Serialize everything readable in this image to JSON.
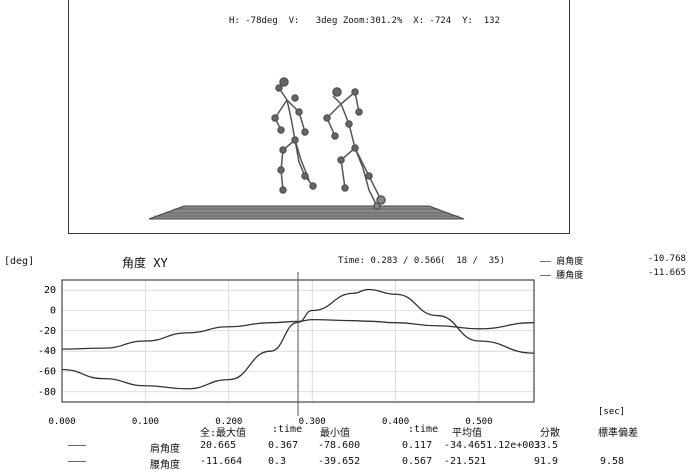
{
  "viewport": {
    "hud": {
      "h": "H: -78deg",
      "v": "V:   3deg",
      "zoom": "Zoom:301.2%",
      "x": "X: -724",
      "y": "Y:  132"
    }
  },
  "graph": {
    "unit": "[deg]",
    "title": "角度 XY",
    "time_readout": "Time: 0.283 / 0.566",
    "frame_readout": "(  18 /  35)",
    "legend": [
      {
        "label": "肩角度",
        "value": "-10.768"
      },
      {
        "label": "腰角度",
        "value": "-11.665"
      }
    ]
  },
  "chart_data": {
    "type": "line",
    "xlabel": "[sec]",
    "ylabel": "[deg]",
    "xlim": [
      0,
      0.566
    ],
    "ylim": [
      -90,
      30
    ],
    "x_ticks": [
      "0.000",
      "0.100",
      "0.200",
      "0.300",
      "0.400",
      "0.500"
    ],
    "y_ticks": [
      "20",
      "0",
      "-20",
      "-40",
      "-60",
      "-80"
    ],
    "cursor_x": 0.283,
    "series": [
      {
        "name": "肩角度",
        "x": [
          0,
          0.05,
          0.1,
          0.15,
          0.2,
          0.25,
          0.283,
          0.3,
          0.35,
          0.367,
          0.4,
          0.45,
          0.5,
          0.566
        ],
        "y": [
          -38,
          -37,
          -30,
          -22,
          -16,
          -12,
          -10.768,
          -9,
          -10,
          -10.5,
          -12,
          -15,
          -18,
          -12
        ]
      },
      {
        "name": "腰角度",
        "x": [
          0,
          0.05,
          0.1,
          0.15,
          0.2,
          0.25,
          0.283,
          0.3,
          0.35,
          0.367,
          0.4,
          0.45,
          0.5,
          0.566
        ],
        "y": [
          -58,
          -67,
          -74,
          -77,
          -68,
          -40,
          -11.665,
          0,
          17,
          20.665,
          16,
          -5,
          -30,
          -42
        ]
      }
    ]
  },
  "stats": {
    "headers": [
      "全:最大值",
      ":time",
      "最小值",
      ":time",
      "平均值",
      "分散",
      "標準偏差"
    ],
    "rows": [
      {
        "label": "肩角度",
        "cells": [
          "20.665",
          "0.367",
          "-78.600",
          "0.117",
          "-34.4651.12e+003",
          "33.5"
        ]
      },
      {
        "label": "腰角度",
        "cells": [
          "-11.664",
          "0.3",
          "-39.652",
          "0.567",
          "-21.521",
          "91.9",
          "9.58"
        ]
      }
    ]
  },
  "colors": {
    "line": "#333333",
    "grid": "#c8c8c8",
    "floor": "#555555",
    "joint": "#444444"
  }
}
